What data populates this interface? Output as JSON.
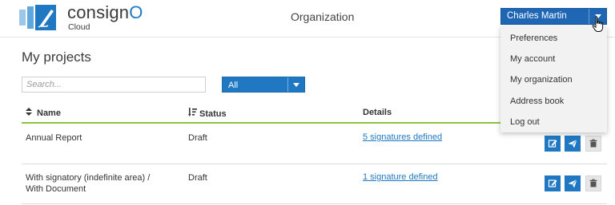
{
  "header": {
    "logo": {
      "name_prefix": "consign",
      "name_accent": "O",
      "subtitle": "Cloud"
    },
    "title": "Organization"
  },
  "user_menu": {
    "user_name": "Charles Martin",
    "items": [
      "Preferences",
      "My account",
      "My organization",
      "Address book",
      "Log out"
    ]
  },
  "main": {
    "title": "My projects",
    "search": {
      "placeholder": "Search...",
      "value": ""
    },
    "filter": {
      "selected": "All"
    },
    "table": {
      "columns": [
        {
          "label": "Name",
          "icon": "sort-icon"
        },
        {
          "label": "Status",
          "icon": "sort-desc-icon"
        },
        {
          "label": "Details",
          "icon": ""
        }
      ],
      "rows": [
        {
          "name": "Annual Report",
          "status": "Draft",
          "details": "5 signatures defined"
        },
        {
          "name": "With signatory (indefinite area) / With Document",
          "status": "Draft",
          "details": "1 signature defined"
        }
      ],
      "row_actions": [
        "edit-icon",
        "send-icon",
        "trash-icon"
      ]
    }
  },
  "colors": {
    "primary": "#1f78c1",
    "user_button": "#1f67b5",
    "header_rule": "#8cc63f",
    "menu_background": "#f2f2f2"
  }
}
